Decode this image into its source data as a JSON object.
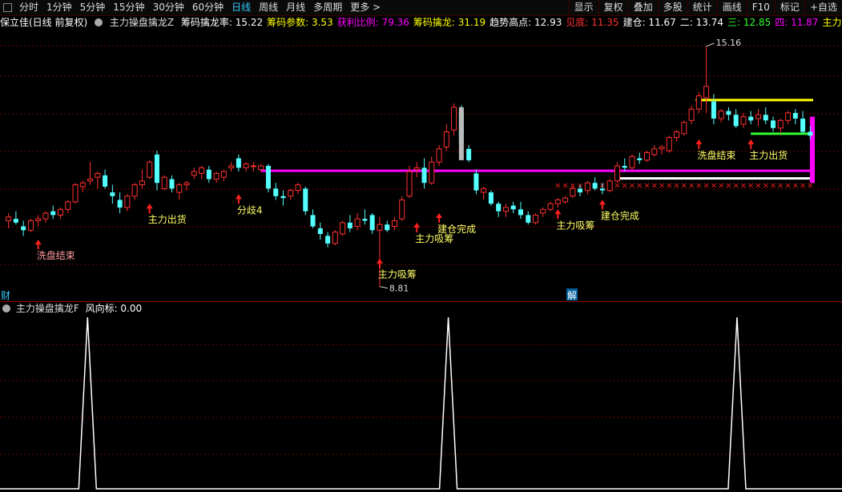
{
  "toolbar": {
    "periods": [
      "分时",
      "1分钟",
      "5分钟",
      "15分钟",
      "30分钟",
      "60分钟",
      "日线",
      "周线",
      "月线",
      "多周期",
      "更多 >"
    ],
    "active_period": "日线",
    "right": [
      "显示",
      "复权",
      "叠加",
      "多股",
      "统计",
      "画线",
      "F10",
      "标记",
      "+自选"
    ]
  },
  "info": {
    "stock": "保立佳(日线 前复权)",
    "indicator": "主力操盘擒龙Z",
    "items": [
      {
        "label": "筹码擒龙率: 15.22",
        "color": "#ffffff"
      },
      {
        "label": "筹码参数: 3.53",
        "color": "#ffff00"
      },
      {
        "label": "获利比例: 79.36",
        "color": "#ff00ff"
      },
      {
        "label": "筹码擒龙: 31.19",
        "color": "#ffff00"
      },
      {
        "label": "趋势高点: 12.93",
        "color": "#ffffff"
      },
      {
        "label": "见底: 11.35",
        "color": "#ff3333"
      },
      {
        "label": "建仓: 11.67",
        "color": "#ffffff"
      },
      {
        "label": "二: 13.74",
        "color": "#ffffff"
      },
      {
        "label": "三: 12.85",
        "color": "#33ff33"
      },
      {
        "label": "四: 11.87",
        "color": "#ff00ff"
      },
      {
        "label": "主力筹码",
        "color": "#ffff00"
      }
    ]
  },
  "main_chart": {
    "price_high_label": "15.16",
    "price_low_label": "8.81",
    "annotations": [
      {
        "text": "洗盘结束",
        "color": "#ff9999"
      },
      {
        "text": "主力出货",
        "color": "#ffff66"
      },
      {
        "text": "分歧4",
        "color": "#ffff66"
      },
      {
        "text": "主力吸筹",
        "color": "#ffff66"
      },
      {
        "text": "主力吸筹",
        "color": "#ffff66"
      },
      {
        "text": "建仓完成",
        "color": "#ffff66"
      },
      {
        "text": "主力吸筹",
        "color": "#ffff66"
      },
      {
        "text": "建仓完成",
        "color": "#ffff66"
      },
      {
        "text": "洗盘结束",
        "color": "#ffff66"
      },
      {
        "text": "主力出货",
        "color": "#ffff66"
      }
    ],
    "left_marker": "财",
    "right_marker": "解"
  },
  "sub_chart": {
    "indicator": "主力操盘擒龙F",
    "value_label": "风向标: 0.00"
  },
  "chart_data": {
    "type": "candlestick",
    "candles": [
      [
        10.55,
        10.75,
        10.35,
        10.65
      ],
      [
        10.6,
        10.8,
        10.45,
        10.5
      ],
      [
        10.4,
        10.55,
        10.15,
        10.3
      ],
      [
        10.3,
        10.6,
        10.25,
        10.55
      ],
      [
        10.55,
        10.7,
        10.4,
        10.6
      ],
      [
        10.6,
        10.8,
        10.5,
        10.75
      ],
      [
        10.8,
        10.95,
        10.6,
        10.7
      ],
      [
        10.7,
        10.9,
        10.6,
        10.85
      ],
      [
        10.85,
        11.1,
        10.75,
        11.05
      ],
      [
        11.05,
        11.55,
        11.0,
        11.5
      ],
      [
        11.45,
        11.6,
        11.3,
        11.55
      ],
      [
        11.6,
        12.1,
        11.5,
        11.65
      ],
      [
        11.7,
        11.85,
        11.4,
        11.8
      ],
      [
        11.75,
        11.9,
        11.4,
        11.45
      ],
      [
        11.3,
        11.5,
        11.0,
        11.2
      ],
      [
        11.1,
        11.3,
        10.75,
        10.9
      ],
      [
        10.9,
        11.25,
        10.8,
        11.2
      ],
      [
        11.2,
        11.55,
        11.1,
        11.5
      ],
      [
        11.5,
        11.9,
        11.4,
        11.6
      ],
      [
        11.7,
        12.15,
        11.65,
        12.1
      ],
      [
        12.3,
        12.4,
        11.35,
        11.55
      ],
      [
        11.4,
        11.75,
        11.35,
        11.7
      ],
      [
        11.65,
        11.75,
        11.3,
        11.4
      ],
      [
        11.3,
        11.55,
        11.1,
        11.5
      ],
      [
        11.5,
        11.6,
        11.35,
        11.55
      ],
      [
        11.75,
        11.95,
        11.65,
        11.85
      ],
      [
        11.8,
        12.0,
        11.65,
        11.95
      ],
      [
        11.9,
        12.0,
        11.55,
        11.65
      ],
      [
        11.65,
        11.85,
        11.55,
        11.8
      ],
      [
        11.7,
        11.9,
        11.6,
        11.85
      ],
      [
        11.95,
        12.1,
        11.85,
        12.0
      ],
      [
        12.2,
        12.3,
        11.85,
        11.95
      ],
      [
        11.95,
        12.1,
        11.85,
        12.05
      ],
      [
        12.0,
        12.1,
        11.85,
        12.0
      ],
      [
        11.9,
        12.05,
        11.85,
        12.0
      ],
      [
        12.0,
        12.05,
        11.3,
        11.4
      ],
      [
        11.4,
        11.55,
        11.1,
        11.2
      ],
      [
        11.2,
        11.35,
        10.95,
        11.15
      ],
      [
        11.2,
        11.4,
        11.1,
        11.35
      ],
      [
        11.35,
        11.55,
        11.25,
        11.5
      ],
      [
        11.4,
        11.45,
        10.7,
        10.8
      ],
      [
        10.7,
        10.85,
        10.35,
        10.4
      ],
      [
        10.35,
        10.5,
        10.05,
        10.2
      ],
      [
        10.15,
        10.25,
        9.85,
        9.95
      ],
      [
        9.95,
        10.3,
        9.9,
        10.25
      ],
      [
        10.2,
        10.55,
        10.15,
        10.5
      ],
      [
        10.5,
        10.7,
        10.25,
        10.35
      ],
      [
        10.4,
        10.75,
        10.3,
        10.6
      ],
      [
        10.6,
        10.85,
        10.45,
        10.55
      ],
      [
        10.7,
        10.75,
        10.2,
        10.3
      ],
      [
        10.3,
        10.65,
        8.81,
        10.45
      ],
      [
        10.45,
        10.55,
        10.25,
        10.3
      ],
      [
        10.4,
        10.65,
        10.3,
        10.55
      ],
      [
        10.6,
        11.2,
        10.55,
        11.1
      ],
      [
        11.2,
        12.0,
        11.15,
        11.85
      ],
      [
        11.9,
        12.1,
        11.7,
        11.95
      ],
      [
        11.95,
        12.2,
        11.4,
        11.55
      ],
      [
        11.55,
        12.25,
        11.5,
        12.1
      ],
      [
        12.1,
        12.55,
        12.0,
        12.45
      ],
      [
        12.5,
        13.1,
        12.4,
        12.9
      ],
      [
        12.95,
        13.65,
        12.8,
        13.55
      ],
      [
        13.45,
        13.6,
        12.55,
        12.6
      ],
      [
        12.45,
        12.55,
        12.1,
        12.15
      ],
      [
        11.8,
        11.9,
        11.25,
        11.35
      ],
      [
        11.3,
        11.45,
        11.1,
        11.4
      ],
      [
        11.3,
        11.35,
        10.95,
        11.0
      ],
      [
        11.0,
        11.05,
        10.65,
        10.8
      ],
      [
        10.8,
        11.0,
        10.65,
        10.9
      ],
      [
        10.95,
        11.05,
        10.75,
        10.85
      ],
      [
        10.85,
        11.05,
        10.6,
        10.7
      ],
      [
        10.7,
        10.8,
        10.45,
        10.5
      ],
      [
        10.5,
        10.75,
        10.45,
        10.7
      ],
      [
        10.75,
        10.9,
        10.65,
        10.85
      ],
      [
        10.85,
        11.05,
        10.8,
        11.0
      ],
      [
        11.0,
        11.15,
        10.9,
        11.1
      ],
      [
        11.05,
        11.2,
        11.0,
        11.15
      ],
      [
        11.2,
        11.45,
        11.15,
        11.4
      ],
      [
        11.4,
        11.5,
        11.2,
        11.3
      ],
      [
        11.35,
        11.6,
        11.25,
        11.55
      ],
      [
        11.55,
        11.7,
        11.35,
        11.4
      ],
      [
        11.4,
        11.55,
        11.25,
        11.35
      ],
      [
        11.35,
        11.65,
        11.3,
        11.6
      ],
      [
        11.6,
        12.1,
        11.55,
        12.0
      ],
      [
        12.0,
        12.2,
        11.85,
        11.95
      ],
      [
        11.95,
        12.3,
        11.9,
        12.25
      ],
      [
        12.2,
        12.35,
        12.05,
        12.15
      ],
      [
        12.15,
        12.4,
        12.1,
        12.35
      ],
      [
        12.3,
        12.55,
        12.25,
        12.45
      ],
      [
        12.45,
        12.55,
        12.3,
        12.5
      ],
      [
        12.4,
        12.8,
        12.35,
        12.75
      ],
      [
        12.75,
        12.95,
        12.65,
        12.9
      ],
      [
        12.85,
        13.2,
        12.8,
        13.15
      ],
      [
        13.2,
        13.6,
        13.1,
        13.5
      ],
      [
        13.5,
        13.95,
        13.4,
        13.85
      ],
      [
        13.8,
        15.16,
        13.4,
        14.1
      ],
      [
        13.7,
        13.9,
        13.1,
        13.25
      ],
      [
        13.25,
        13.5,
        13.15,
        13.45
      ],
      [
        13.45,
        13.55,
        13.2,
        13.35
      ],
      [
        13.35,
        13.5,
        13.0,
        13.05
      ],
      [
        13.1,
        13.4,
        13.0,
        13.3
      ],
      [
        13.3,
        13.45,
        13.1,
        13.2
      ],
      [
        13.25,
        13.5,
        13.05,
        13.35
      ],
      [
        13.35,
        13.55,
        13.1,
        13.2
      ],
      [
        13.2,
        13.3,
        12.9,
        13.0
      ],
      [
        13.0,
        13.25,
        12.85,
        13.2
      ],
      [
        13.2,
        13.45,
        13.1,
        13.4
      ],
      [
        13.4,
        13.5,
        13.1,
        13.25
      ],
      [
        13.25,
        13.45,
        12.85,
        12.9
      ],
      [
        12.9,
        13.05,
        12.7,
        12.8
      ]
    ],
    "overlay_lines": [
      {
        "name": "二",
        "value": 13.74,
        "color": "#ffff00"
      },
      {
        "name": "三",
        "value": 12.85,
        "color": "#33ff33"
      },
      {
        "name": "四",
        "value": 11.87,
        "color": "#ff00ff"
      },
      {
        "name": "建仓",
        "value": 11.67,
        "color": "#ffffff"
      }
    ],
    "ylim": [
      8.4,
      15.6
    ],
    "sub_peaks_at": [
      10,
      60,
      99
    ]
  }
}
